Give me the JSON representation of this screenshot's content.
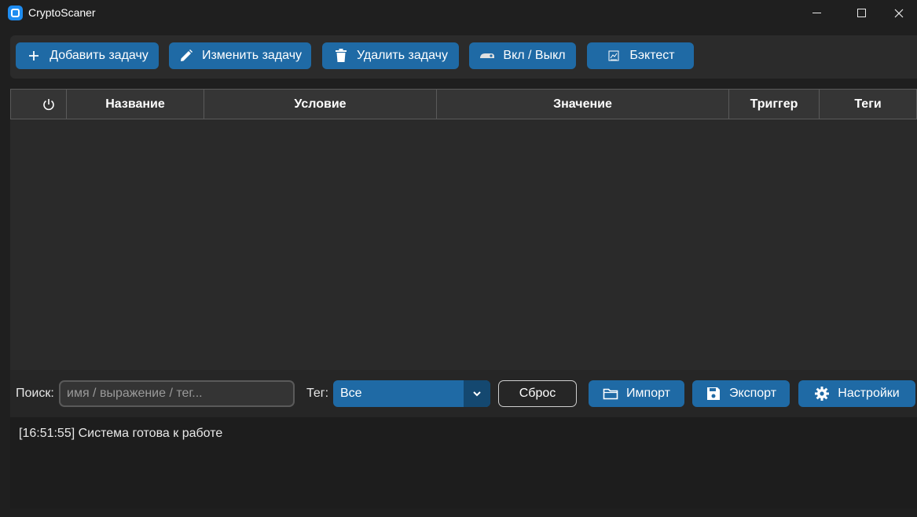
{
  "window": {
    "title": "CryptoScaner",
    "controls": [
      "minimize",
      "maximize",
      "close"
    ]
  },
  "toolbar": {
    "buttons": [
      {
        "label": "Добавить задачу",
        "icon": "plus-icon"
      },
      {
        "label": "Изменить задачу",
        "icon": "pencil-icon"
      },
      {
        "label": "Удалить задачу",
        "icon": "trash-icon"
      },
      {
        "label": "Вкл / Выкл",
        "icon": "toggle-icon"
      },
      {
        "label": "Бэктест",
        "icon": "chart-icon"
      }
    ]
  },
  "table": {
    "columns": [
      {
        "label": "",
        "icon": "power-icon"
      },
      {
        "label": "Название"
      },
      {
        "label": "Условие"
      },
      {
        "label": "Значение"
      },
      {
        "label": "Триггер"
      },
      {
        "label": "Теги"
      }
    ],
    "rows": []
  },
  "filters": {
    "search_label": "Поиск:",
    "search_placeholder": "имя / выражение / тег...",
    "search_value": "",
    "tag_label": "Тег:",
    "tag_selected": "Все",
    "reset_label": "Сброс",
    "import_label": "Импорт",
    "export_label": "Экспорт",
    "settings_label": "Настройки"
  },
  "log": {
    "lines": [
      "[16:51:55] Система готова к работе"
    ]
  },
  "colors": {
    "accent": "#1f6aa5",
    "accent_dark": "#144870",
    "background": "#1f1f1f",
    "panel": "#2b2b2b",
    "header": "#353535",
    "app_icon": "#1e8cf0"
  }
}
